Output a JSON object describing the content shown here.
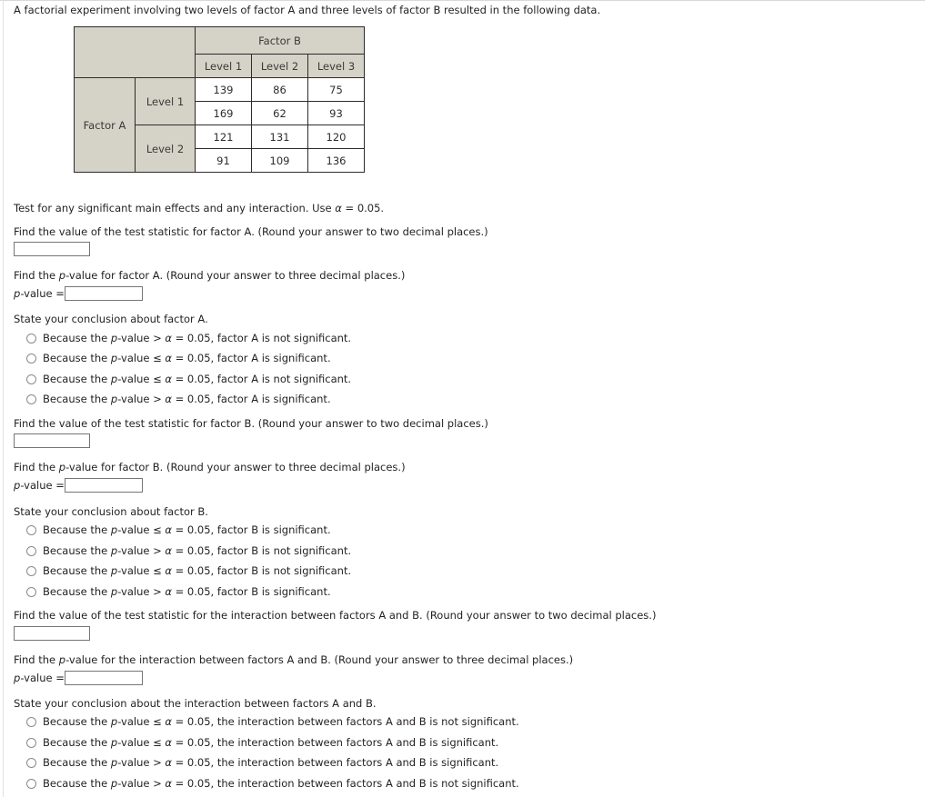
{
  "intro": "A factorial experiment involving two levels of factor A and three levels of factor B resulted in the following data.",
  "table": {
    "factor_b_label": "Factor B",
    "factor_a_label": "Factor A",
    "column_headers": [
      "Level 1",
      "Level 2",
      "Level 3"
    ],
    "row_groups": [
      {
        "label": "Level 1",
        "rows": [
          [
            "139",
            "86",
            "75"
          ],
          [
            "169",
            "62",
            "93"
          ]
        ]
      },
      {
        "label": "Level 2",
        "rows": [
          [
            "121",
            "131",
            "120"
          ],
          [
            "91",
            "109",
            "136"
          ]
        ]
      }
    ]
  },
  "instruction": {
    "pre_alpha": "Test for any significant main effects and any interaction. Use ",
    "alpha": "α",
    "post_alpha": " = 0.05."
  },
  "sections": [
    {
      "statistic_prompt_pre": "Find the value of the test statistic for factor A. (Round your answer to two decimal places.)",
      "statistic_value": "",
      "statistic_placeholder": "",
      "pvalue_prompt_a": "Find the ",
      "pvalue_prompt_italic": "p",
      "pvalue_prompt_b": "-value for factor A. (Round your answer to three decimal places.)",
      "pvalue_label_italic": "p",
      "pvalue_label_rest": "-value = ",
      "pvalue_value": "",
      "conclusion_prompt": "State your conclusion about factor A.",
      "options": [
        {
          "pre": "Because the ",
          "ital": "p",
          "mid": "-value > ",
          "alpha": "α",
          "post": " = 0.05, factor A is not significant."
        },
        {
          "pre": "Because the ",
          "ital": "p",
          "mid": "-value ≤ ",
          "alpha": "α",
          "post": " = 0.05, factor A is significant."
        },
        {
          "pre": "Because the ",
          "ital": "p",
          "mid": "-value ≤ ",
          "alpha": "α",
          "post": " = 0.05, factor A is not significant."
        },
        {
          "pre": "Because the ",
          "ital": "p",
          "mid": "-value > ",
          "alpha": "α",
          "post": " = 0.05, factor A is significant."
        }
      ]
    },
    {
      "statistic_prompt_pre": "Find the value of the test statistic for factor B. (Round your answer to two decimal places.)",
      "statistic_value": "",
      "pvalue_prompt_a": "Find the ",
      "pvalue_prompt_italic": "p",
      "pvalue_prompt_b": "-value for factor B. (Round your answer to three decimal places.)",
      "pvalue_label_italic": "p",
      "pvalue_label_rest": "-value = ",
      "pvalue_value": "",
      "conclusion_prompt": "State your conclusion about factor B.",
      "options": [
        {
          "pre": "Because the ",
          "ital": "p",
          "mid": "-value ≤ ",
          "alpha": "α",
          "post": " = 0.05, factor B is significant."
        },
        {
          "pre": "Because the ",
          "ital": "p",
          "mid": "-value > ",
          "alpha": "α",
          "post": " = 0.05, factor B is not significant."
        },
        {
          "pre": "Because the ",
          "ital": "p",
          "mid": "-value ≤ ",
          "alpha": "α",
          "post": " = 0.05, factor B is not significant."
        },
        {
          "pre": "Because the ",
          "ital": "p",
          "mid": "-value > ",
          "alpha": "α",
          "post": " = 0.05, factor B is significant."
        }
      ]
    },
    {
      "statistic_prompt_pre": "Find the value of the test statistic for the interaction between factors A and B. (Round your answer to two decimal places.)",
      "statistic_value": "",
      "pvalue_prompt_a": "Find the ",
      "pvalue_prompt_italic": "p",
      "pvalue_prompt_b": "-value for the interaction between factors A and B. (Round your answer to three decimal places.)",
      "pvalue_label_italic": "p",
      "pvalue_label_rest": "-value = ",
      "pvalue_value": "",
      "conclusion_prompt": "State your conclusion about the interaction between factors A and B.",
      "options": [
        {
          "pre": "Because the ",
          "ital": "p",
          "mid": "-value ≤ ",
          "alpha": "α",
          "post": " = 0.05, the interaction between factors A and B is not significant."
        },
        {
          "pre": "Because the ",
          "ital": "p",
          "mid": "-value ≤ ",
          "alpha": "α",
          "post": " = 0.05, the interaction between factors A and B is significant."
        },
        {
          "pre": "Because the ",
          "ital": "p",
          "mid": "-value > ",
          "alpha": "α",
          "post": " = 0.05, the interaction between factors A and B is significant."
        },
        {
          "pre": "Because the ",
          "ital": "p",
          "mid": "-value > ",
          "alpha": "α",
          "post": " = 0.05, the interaction between factors A and B is not significant."
        }
      ]
    }
  ],
  "colors": {
    "header_fill": "#d5d2c8",
    "border": "#2b2b2b",
    "text": "#231f20"
  }
}
